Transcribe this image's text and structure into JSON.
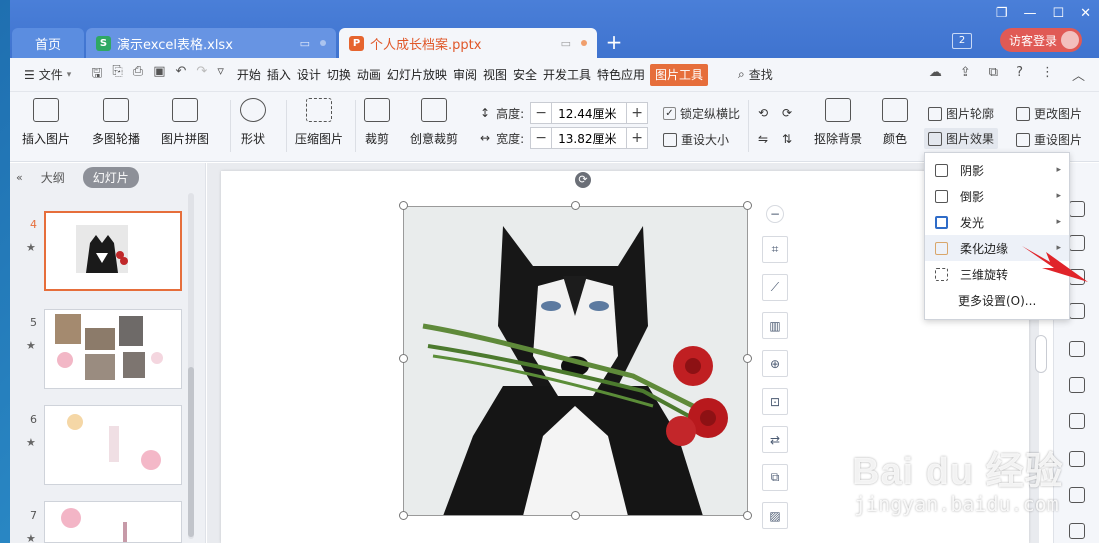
{
  "tabs": {
    "home": "首页",
    "excel": "演示excel表格.xlsx",
    "ppt": "个人成长档案.pptx"
  },
  "window": {
    "counter": "2",
    "guest_login": "访客登录"
  },
  "menubar": {
    "file": "文件",
    "items": [
      "开始",
      "插入",
      "设计",
      "切换",
      "动画",
      "幻灯片放映",
      "审阅",
      "视图",
      "安全",
      "开发工具",
      "特色应用",
      "图片工具"
    ],
    "search": "查找"
  },
  "ribbon": {
    "insert_picture": "插入图片",
    "multi_carousel": "多图轮播",
    "picture_collage": "图片拼图",
    "shape": "形状",
    "compress": "压缩图片",
    "crop": "裁剪",
    "creative_crop": "创意裁剪",
    "height_label": "高度:",
    "height_value": "12.44厘米",
    "width_label": "宽度:",
    "width_value": "13.82厘米",
    "lock_ratio": "锁定纵横比",
    "reset_size": "重设大小",
    "remove_bg": "抠除背景",
    "color": "颜色",
    "picture_outline": "图片轮廓",
    "picture_effect": "图片效果",
    "change_picture": "更改图片",
    "reset_picture": "重设图片"
  },
  "left_panel": {
    "outline_tab": "大纲",
    "slides_tab": "幻灯片",
    "slides": [
      {
        "num": "4",
        "selected": true
      },
      {
        "num": "5",
        "selected": false
      },
      {
        "num": "6",
        "selected": false
      },
      {
        "num": "7",
        "selected": false
      }
    ]
  },
  "dropdown": {
    "items": [
      "阴影",
      "倒影",
      "发光",
      "柔化边缘",
      "三维旋转"
    ],
    "more": "更多设置(O)..."
  },
  "watermark": {
    "brand": "Bai du 经验",
    "sub": "jingyan.baidu.com"
  },
  "colors": {
    "accent": "#e66e3b",
    "titlebar": "#3f73cf"
  }
}
